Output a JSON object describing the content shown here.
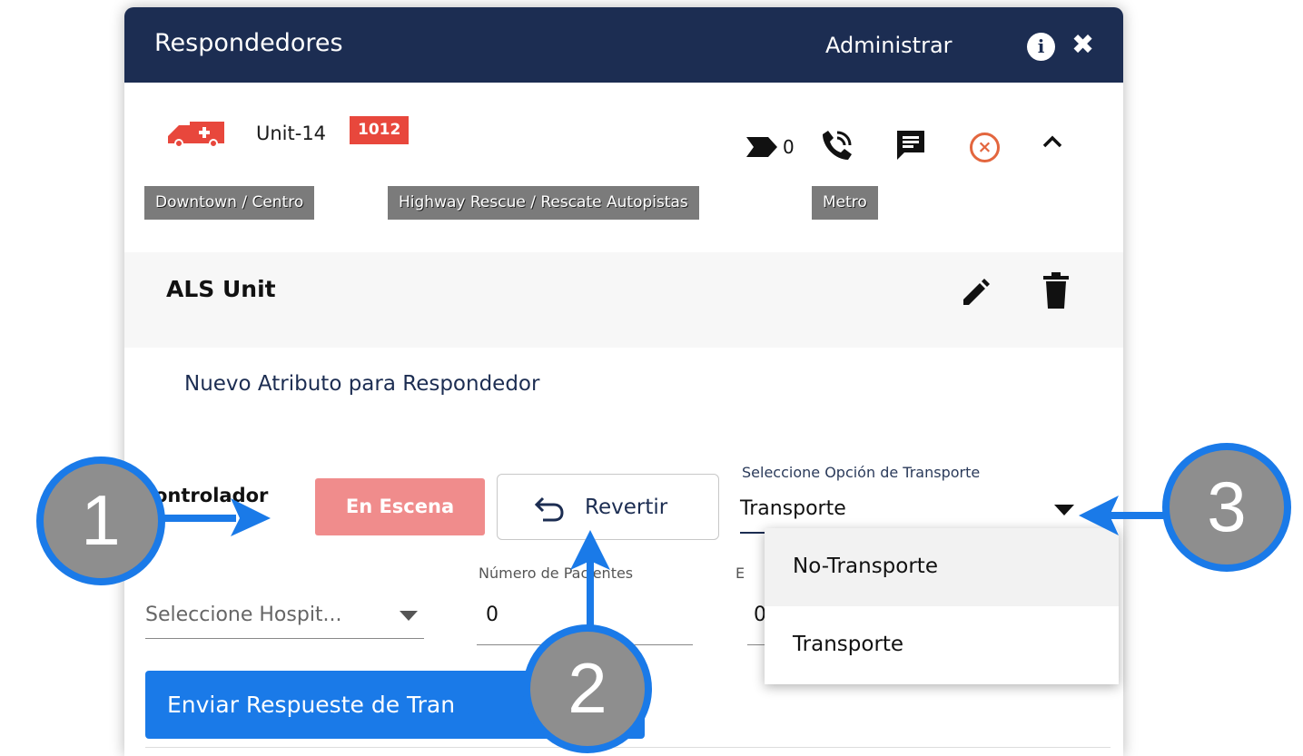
{
  "header": {
    "title": "Respondedores",
    "admin_label": "Administrar"
  },
  "unit": {
    "name": "Unit-14",
    "code": "1012",
    "message_count": "0"
  },
  "tags": [
    "Downtown / Centro",
    "Highway Rescue / Rescate Autopistas",
    "Metro"
  ],
  "section": {
    "title": "ALS Unit",
    "new_attribute": "Nuevo Atributo para Respondedor"
  },
  "controller": {
    "label": "ontrolador",
    "status_button": "En Escena",
    "revert_button": "Revertir"
  },
  "transport": {
    "label": "Seleccione Opción de Transporte",
    "value": "Transporte",
    "options": [
      "No-Transporte",
      "Transporte"
    ]
  },
  "hospital": {
    "placeholder": "Seleccione Hospit..."
  },
  "patients": {
    "label": "Número de Pacientes",
    "value": "0"
  },
  "third_field": {
    "label": "E",
    "value": "0"
  },
  "send_button": "Enviar Respueste de Tran",
  "callouts": [
    "1",
    "2",
    "3"
  ],
  "colors": {
    "header_bg": "#1c2d52",
    "badge_red": "#e8473c",
    "en_escena": "#f08c8c",
    "primary_blue": "#1a7ae8",
    "cancel_orange": "#e3663e",
    "tag_gray": "#7b7b7b",
    "callout_gray": "#8e8e8e"
  },
  "icons": [
    "ambulance-icon",
    "message-tag-icon",
    "phone-icon",
    "chat-icon",
    "cancel-icon",
    "chevron-up-icon",
    "edit-icon",
    "trash-icon",
    "undo-icon",
    "caret-down-icon",
    "info-icon",
    "close-icon"
  ]
}
